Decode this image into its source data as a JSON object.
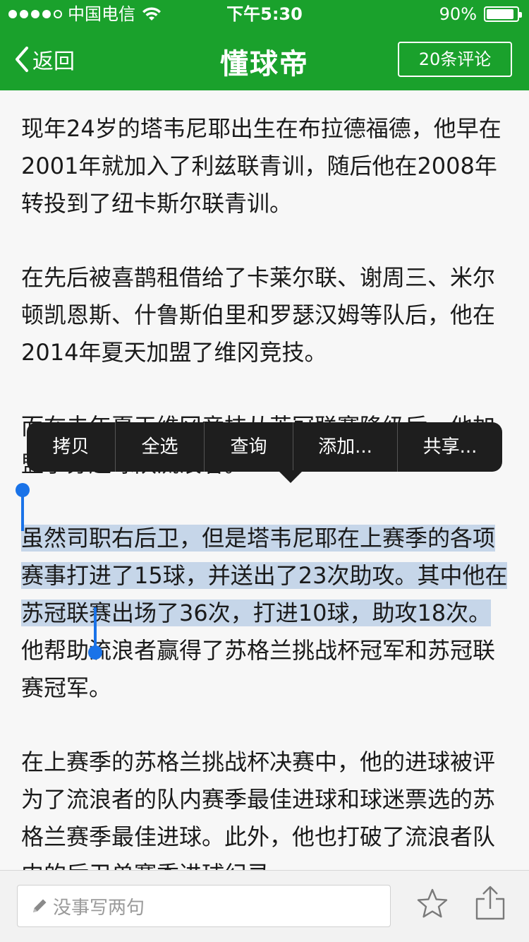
{
  "status_bar": {
    "carrier": "中国电信",
    "time": "下午5:30",
    "battery_text": "90%",
    "battery_level": 0.9
  },
  "nav": {
    "back_label": "返回",
    "title": "懂球帝",
    "comments_label": "20条评论"
  },
  "article": {
    "p1": "现年24岁的塔韦尼耶出生在布拉德福德，他早在2001年就加入了利兹联青训，随后他在2008年转投到了纽卡斯尔联青训。",
    "p2": "在先后被喜鹊租借给了卡莱尔联、谢周三、米尔顿凯恩斯、什鲁斯伯里和罗瑟汉姆等队后，他在2014年夏天加盟了维冈竞技。",
    "p3": "而在去年夏天维冈竞技从英冠联赛降级后，他加盟了苏超球队流浪者。",
    "p4_selected": "虽然司职右后卫，但是塔韦尼耶在上赛季的各项赛事打进了15球，并送出了23次助攻。其中他在苏冠联赛出场了36次，打进10球，助攻18次。",
    "p4_rest": "他帮助流浪者赢得了苏格兰挑战杯冠军和苏冠联赛冠军。",
    "p5": "在上赛季的苏格兰挑战杯决赛中，他的进球被评为了流浪者的队内赛季最佳进球和球迷票选的苏格兰赛季最佳进球。此外，他也打破了流浪者队内的后卫单赛季进球纪录。"
  },
  "context_menu": {
    "copy": "拷贝",
    "select_all": "全选",
    "lookup": "查询",
    "add": "添加...",
    "share": "共享..."
  },
  "bottom_bar": {
    "comment_placeholder": "没事写两句"
  },
  "colors": {
    "brand_green": "#1aa12c",
    "selection": "#c6d6e9",
    "handle": "#1a73e8"
  }
}
